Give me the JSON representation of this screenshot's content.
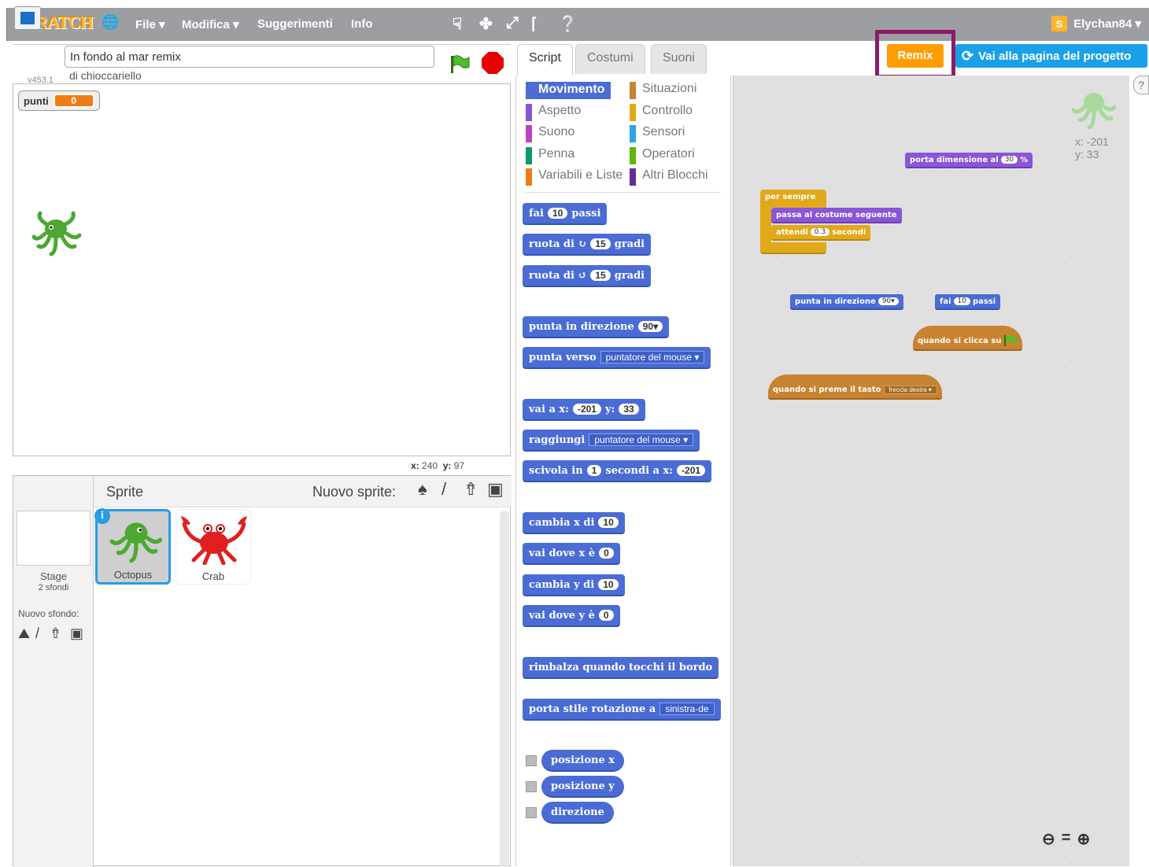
{
  "menubar": {
    "logo": "SCRATCH",
    "items": [
      "File ▾",
      "Modifica ▾",
      "Suggerimenti",
      "Info"
    ],
    "tools": [
      "duplicate-icon",
      "delete-icon",
      "grow-icon",
      "shrink-icon",
      "help-icon"
    ],
    "user": "Elychan84 ▾"
  },
  "stage_header": {
    "version": "v453.1",
    "project_title": "In fondo al mar remix",
    "author": "di chioccariello"
  },
  "stage": {
    "variable": {
      "name": "punti",
      "value": "0"
    },
    "mouse_x_label": "x:",
    "mouse_x": "240",
    "mouse_y_label": "y:",
    "mouse_y": "97"
  },
  "sprite_pane": {
    "title": "Sprite",
    "new_sprite": "Nuovo sprite:",
    "stage_label": "Stage",
    "stage_count": "2 sfondi",
    "new_backdrop": "Nuovo sfondo:",
    "sprites": [
      {
        "name": "Octopus",
        "selected": true
      },
      {
        "name": "Crab",
        "selected": false
      }
    ]
  },
  "tabs": [
    "Script",
    "Costumi",
    "Suoni"
  ],
  "actions": {
    "remix": "Remix",
    "project_page": "Vai alla pagina del progetto"
  },
  "categories": {
    "left": [
      "Movimento",
      "Aspetto",
      "Suono",
      "Penna",
      "Variabili e Liste"
    ],
    "right": [
      "Situazioni",
      "Controllo",
      "Sensori",
      "Operatori",
      "Altri Blocchi"
    ],
    "colors": {
      "Movimento": "#4a6cd4",
      "Aspetto": "#8a55d7",
      "Suono": "#bb42c3",
      "Penna": "#0e9a6c",
      "Variabili e Liste": "#ee7d16",
      "Situazioni": "#c88330",
      "Controllo": "#e1a91a",
      "Sensori": "#2ca5e2",
      "Operatori": "#5cb712",
      "Altri Blocchi": "#632d99"
    }
  },
  "palette": {
    "b_move": {
      "pre": "fai",
      "val": "10",
      "post": "passi"
    },
    "b_turn_r": {
      "pre": "ruota di ↻",
      "val": "15",
      "post": "gradi"
    },
    "b_turn_l": {
      "pre": "ruota di ↺",
      "val": "15",
      "post": "gradi"
    },
    "b_point_dir": {
      "pre": "punta in direzione",
      "val": "90▾"
    },
    "b_point_to": {
      "pre": "punta verso",
      "drop": "puntatore del mouse ▾"
    },
    "b_goto_xy": {
      "pre": "vai a x:",
      "x": "-201",
      "mid": "y:",
      "y": "33"
    },
    "b_goto": {
      "pre": "raggiungi",
      "drop": "puntatore del mouse ▾"
    },
    "b_glide": {
      "pre": "scivola in",
      "val": "1",
      "mid": "secondi a x:",
      "x": "-201"
    },
    "b_change_x": {
      "pre": "cambia x di",
      "val": "10"
    },
    "b_set_x": {
      "pre": "vai dove x è",
      "val": "0"
    },
    "b_change_y": {
      "pre": "cambia y di",
      "val": "10"
    },
    "b_set_y": {
      "pre": "vai dove y è",
      "val": "0"
    },
    "b_bounce": "rimbalza quando tocchi il bordo",
    "b_rotation": {
      "pre": "porta stile rotazione a",
      "drop": "sinistra-de"
    },
    "r_xpos": "posizione x",
    "r_ypos": "posizione y",
    "r_dir": "direzione"
  },
  "script_area": {
    "sprite_x": "x: -201",
    "sprite_y": "y: 33",
    "s_size": {
      "pre": "porta dimensione al",
      "val": "30",
      "post": "%"
    },
    "s_forever": "per sempre",
    "s_next_costume": "passa al costume seguente",
    "s_wait": {
      "pre": "attendi",
      "val": "0.3",
      "post": "secondi"
    },
    "s_point_dir": {
      "pre": "punta in direzione",
      "val": "90▾"
    },
    "s_move": {
      "pre": "fai",
      "val": "10",
      "post": "passi"
    },
    "s_flag_hat": "quando si clicca su",
    "s_key_hat": {
      "pre": "quando si preme il tasto",
      "drop": "freccia destra ▾"
    },
    "zoom": [
      "zoom-out-icon",
      "zoom-reset-icon",
      "zoom-in-icon"
    ]
  }
}
